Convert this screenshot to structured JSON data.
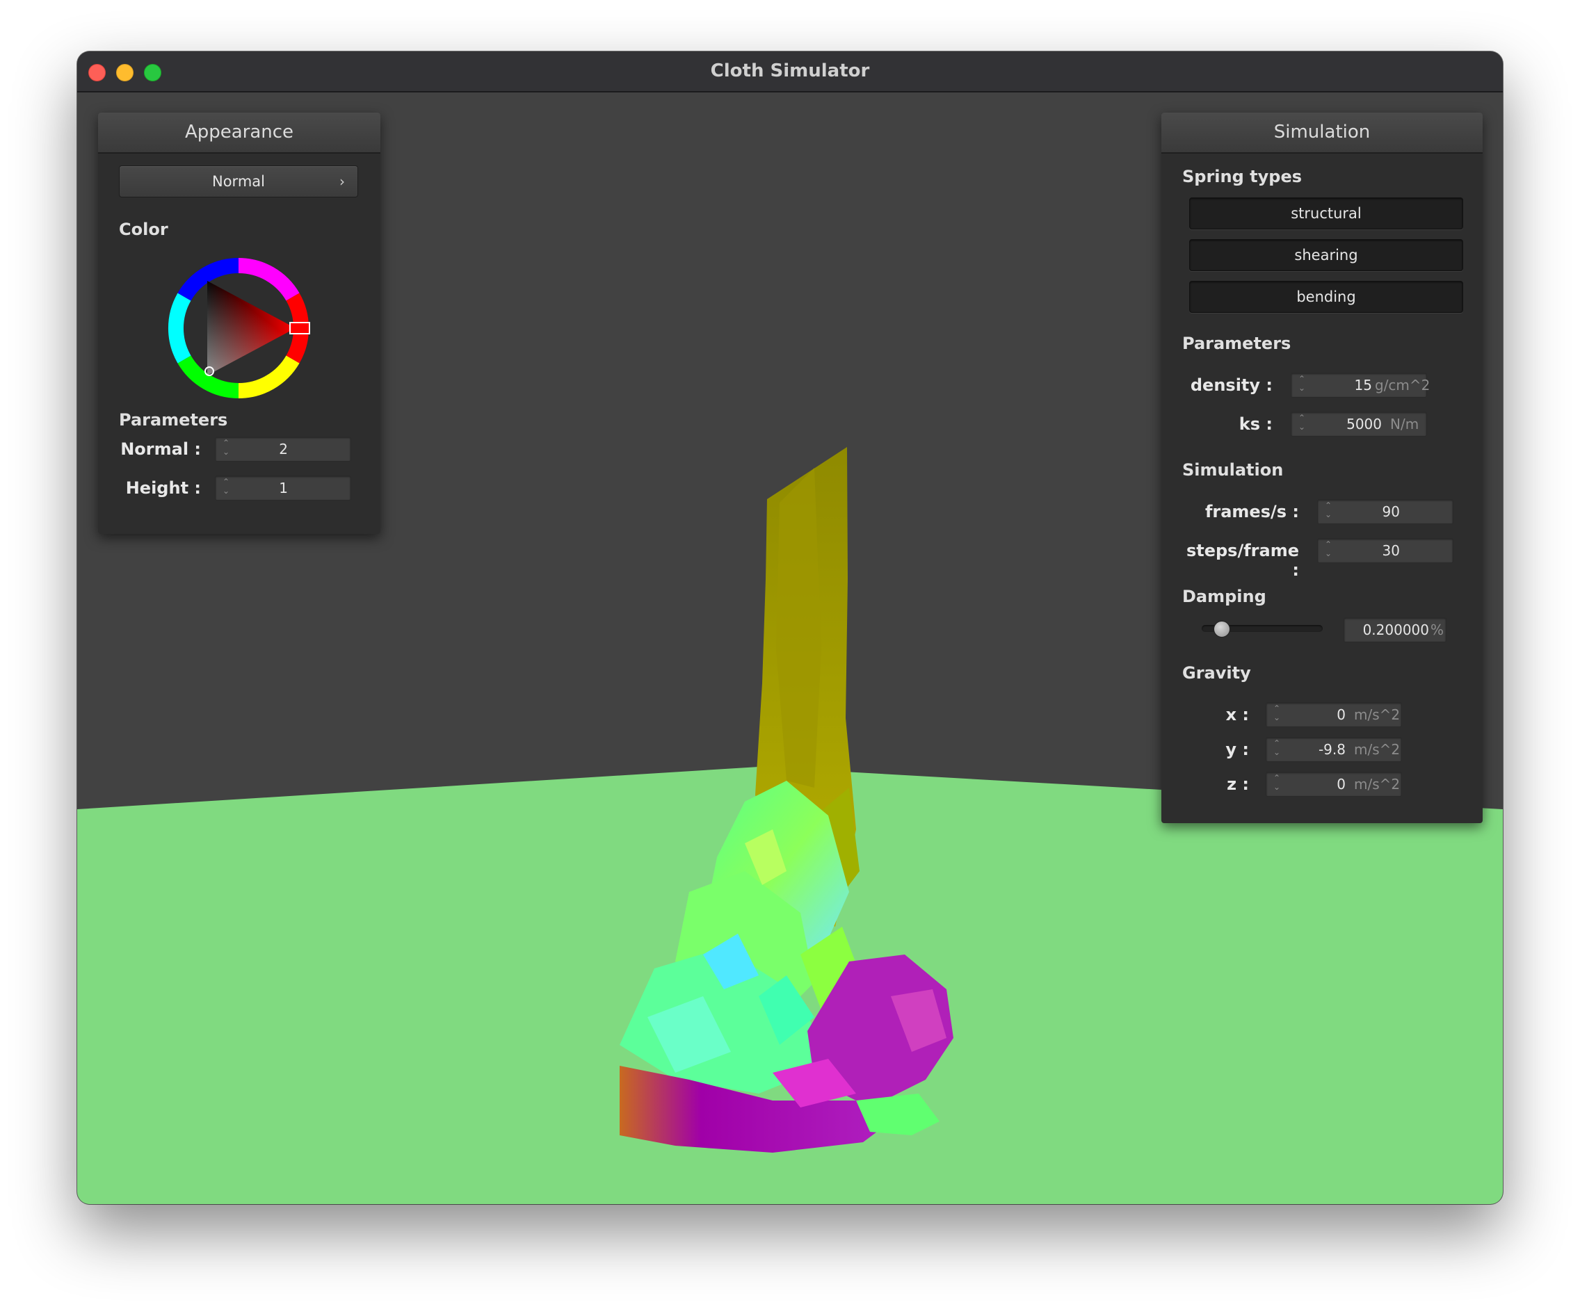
{
  "window": {
    "title": "Cloth Simulator",
    "controls": [
      "close",
      "minimize",
      "maximize"
    ]
  },
  "appearance": {
    "header": "Appearance",
    "shader_select": "Normal",
    "color_label": "Color",
    "selected_color": "#ff0000",
    "parameters_label": "Parameters",
    "params": [
      {
        "label": "Normal :",
        "value": "2"
      },
      {
        "label": "Height :",
        "value": "1"
      }
    ]
  },
  "simulation": {
    "header": "Simulation",
    "spring_types_label": "Spring types",
    "spring_buttons": [
      "structural",
      "shearing",
      "bending"
    ],
    "parameters_label": "Parameters",
    "density": {
      "label": "density :",
      "value": "15",
      "unit": "g/cm^2"
    },
    "ks": {
      "label": "ks :",
      "value": "5000",
      "unit": "N/m"
    },
    "simulation_label": "Simulation",
    "fps": {
      "label": "frames/s :",
      "value": "90"
    },
    "steps": {
      "label": "steps/frame :",
      "value": "30"
    },
    "damping_label": "Damping",
    "damping": {
      "value": "0.200000",
      "unit": "%",
      "slider_fraction": 0.1
    },
    "gravity_label": "Gravity",
    "gravity": [
      {
        "label": "x :",
        "value": "0",
        "unit": "m/s^2"
      },
      {
        "label": "y :",
        "value": "-9.8",
        "unit": "m/s^2"
      },
      {
        "label": "z :",
        "value": "0",
        "unit": "m/s^2"
      }
    ]
  },
  "scene": {
    "background_color": "#424242",
    "ground_color": "#80da80",
    "cloth_top_color": "#a8a000",
    "cloth_mid_color": "#66ff66",
    "cloth_base_color": "#a000a8"
  }
}
